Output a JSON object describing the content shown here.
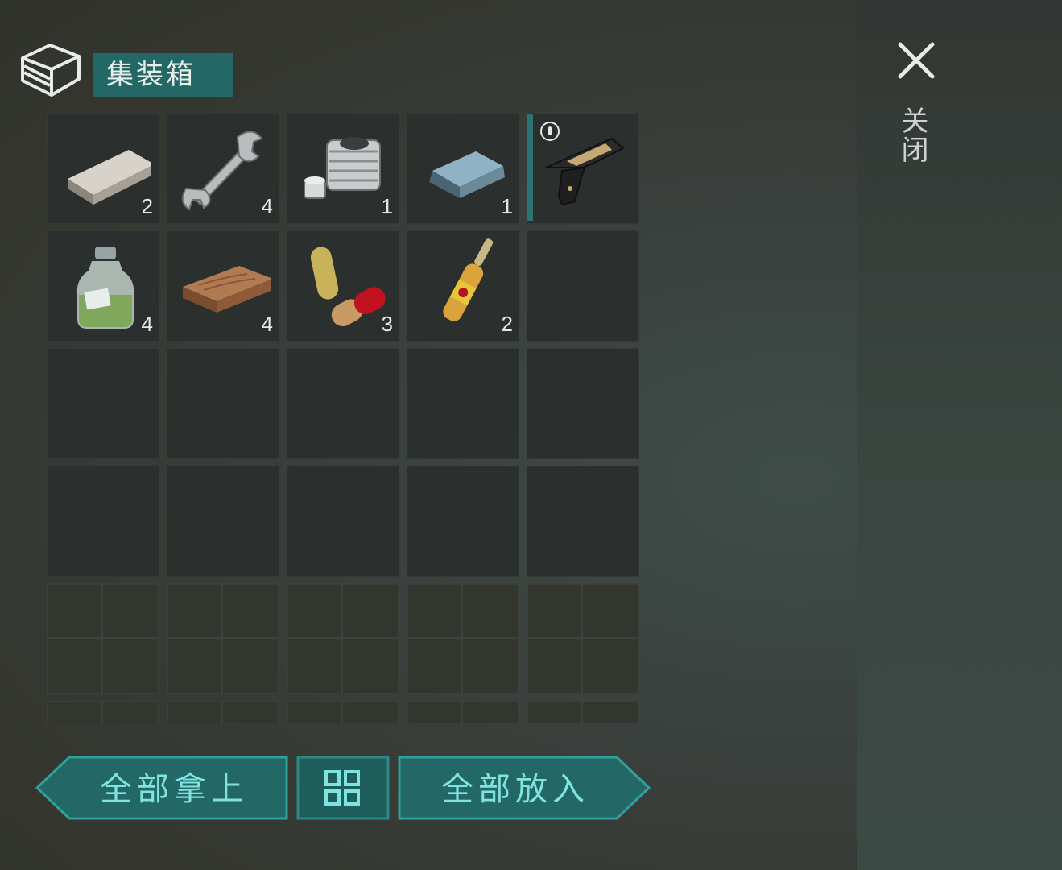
{
  "container": {
    "title": "集装箱",
    "icon": "box-icon"
  },
  "close": {
    "label": "关闭",
    "icon": "close-icon"
  },
  "slots": [
    {
      "item": "steel-bar-icon",
      "qty": "2"
    },
    {
      "item": "wrench-icon",
      "qty": "4"
    },
    {
      "item": "engine-cylinder-icon",
      "qty": "1"
    },
    {
      "item": "metal-ingot-icon",
      "qty": "1"
    },
    {
      "item": "pistol-icon",
      "qty": "",
      "equipped": true,
      "badge": "ammo-badge-icon"
    },
    {
      "item": "chemical-bottle-icon",
      "qty": "4"
    },
    {
      "item": "wood-plank-icon",
      "qty": "4"
    },
    {
      "item": "pills-icon",
      "qty": "3"
    },
    {
      "item": "ampoule-icon",
      "qty": "2"
    },
    {
      "item": "",
      "qty": ""
    }
  ],
  "bottom": {
    "take_all": "全部拿上",
    "sort_icon": "sort-grid-icon",
    "put_all": "全部放入"
  },
  "colors": {
    "accent": "#236766",
    "button_text": "#7fe3e0",
    "button_border": "#2fa09b"
  }
}
